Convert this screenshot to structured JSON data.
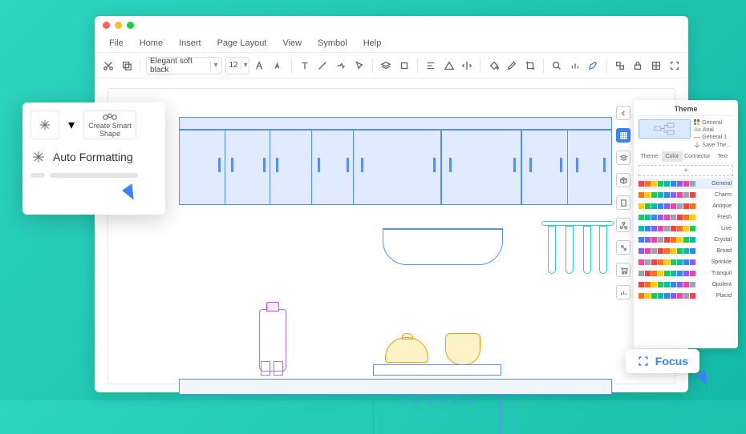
{
  "menu": {
    "file": "File",
    "home": "Home",
    "insert": "Insert",
    "page": "Page Layout",
    "view": "View",
    "symbol": "Symbol",
    "help": "Help"
  },
  "toolbar": {
    "font": "Elegant soft black",
    "size": "12"
  },
  "popup": {
    "smart": "Create Smart\nShape",
    "af": "Auto Formatting"
  },
  "theme": {
    "title": "Theme",
    "cards": [
      "General",
      "Arial",
      "General 1",
      "Save The…"
    ],
    "tabs": [
      "Theme",
      "Color",
      "Connector",
      "Text"
    ],
    "schemes": [
      "General",
      "Charm",
      "Antique",
      "Fresh",
      "Live",
      "Crystal",
      "Broad",
      "Sprinkle",
      "Tranquil",
      "Opulent",
      "Placid"
    ]
  },
  "focus": {
    "label": "Focus"
  },
  "colors": {
    "c1": "#ef4444",
    "c2": "#f97316",
    "c3": "#facc15",
    "c4": "#22c55e",
    "c5": "#14b8a6",
    "c6": "#3b82f6",
    "c7": "#8b5cf6",
    "c8": "#ec4899",
    "c9": "#9ca3af"
  }
}
